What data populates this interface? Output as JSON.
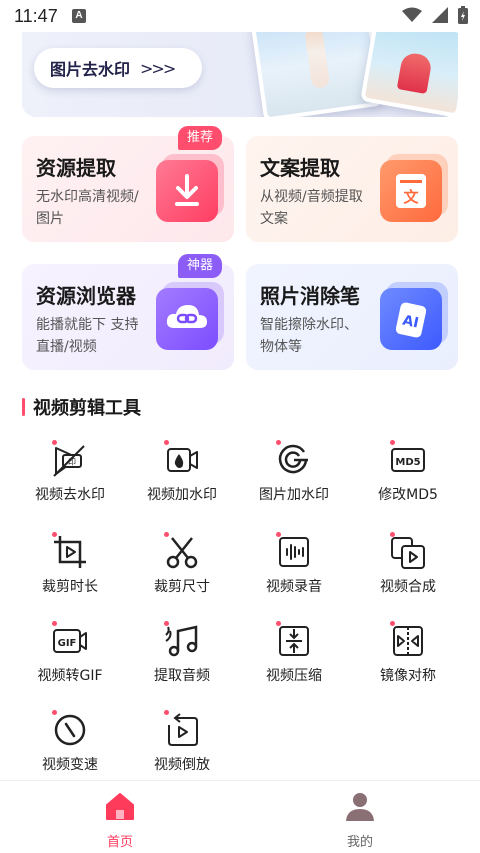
{
  "status_bar": {
    "time": "11:47",
    "notification_badge": "A"
  },
  "banner": {
    "button_label": "图片去水印",
    "arrows": ">>>"
  },
  "feature_cards": [
    {
      "title": "资源提取",
      "description": "无水印高清视频/图片",
      "badge": "推荐",
      "icon": "download-icon",
      "accent": "#ff5c7c"
    },
    {
      "title": "文案提取",
      "description": "从视频/音频提取文案",
      "badge": "",
      "icon": "text-doc-icon",
      "accent": "#ff7a45"
    },
    {
      "title": "资源浏览器",
      "description": "能播就能下 支持直播/视频",
      "badge": "神器",
      "icon": "cloud-link-icon",
      "accent": "#8b5cf6"
    },
    {
      "title": "照片消除笔",
      "description": "智能擦除水印、物体等",
      "badge": "",
      "icon": "ai-eraser-icon",
      "accent": "#4c6ef5"
    }
  ],
  "section": {
    "title": "视频剪辑工具"
  },
  "tools": [
    {
      "label": "视频去水印",
      "icon": "video-remove-watermark-icon"
    },
    {
      "label": "视频加水印",
      "icon": "video-add-watermark-icon"
    },
    {
      "label": "图片加水印",
      "icon": "image-add-watermark-icon"
    },
    {
      "label": "修改MD5",
      "icon": "md5-icon"
    },
    {
      "label": "裁剪时长",
      "icon": "trim-duration-icon"
    },
    {
      "label": "裁剪尺寸",
      "icon": "scissors-icon"
    },
    {
      "label": "视频录音",
      "icon": "audio-record-icon"
    },
    {
      "label": "视频合成",
      "icon": "video-merge-icon"
    },
    {
      "label": "视频转GIF",
      "icon": "gif-icon"
    },
    {
      "label": "提取音频",
      "icon": "music-note-icon"
    },
    {
      "label": "视频压缩",
      "icon": "compress-icon"
    },
    {
      "label": "镜像对称",
      "icon": "mirror-icon"
    },
    {
      "label": "视频变速",
      "icon": "speed-icon"
    },
    {
      "label": "视频倒放",
      "icon": "reverse-icon"
    }
  ],
  "bottom_nav": [
    {
      "label": "首页",
      "icon": "home-icon",
      "active": true,
      "color": "#ff3b5c"
    },
    {
      "label": "我的",
      "icon": "user-icon",
      "active": false,
      "color": "#666666"
    }
  ]
}
